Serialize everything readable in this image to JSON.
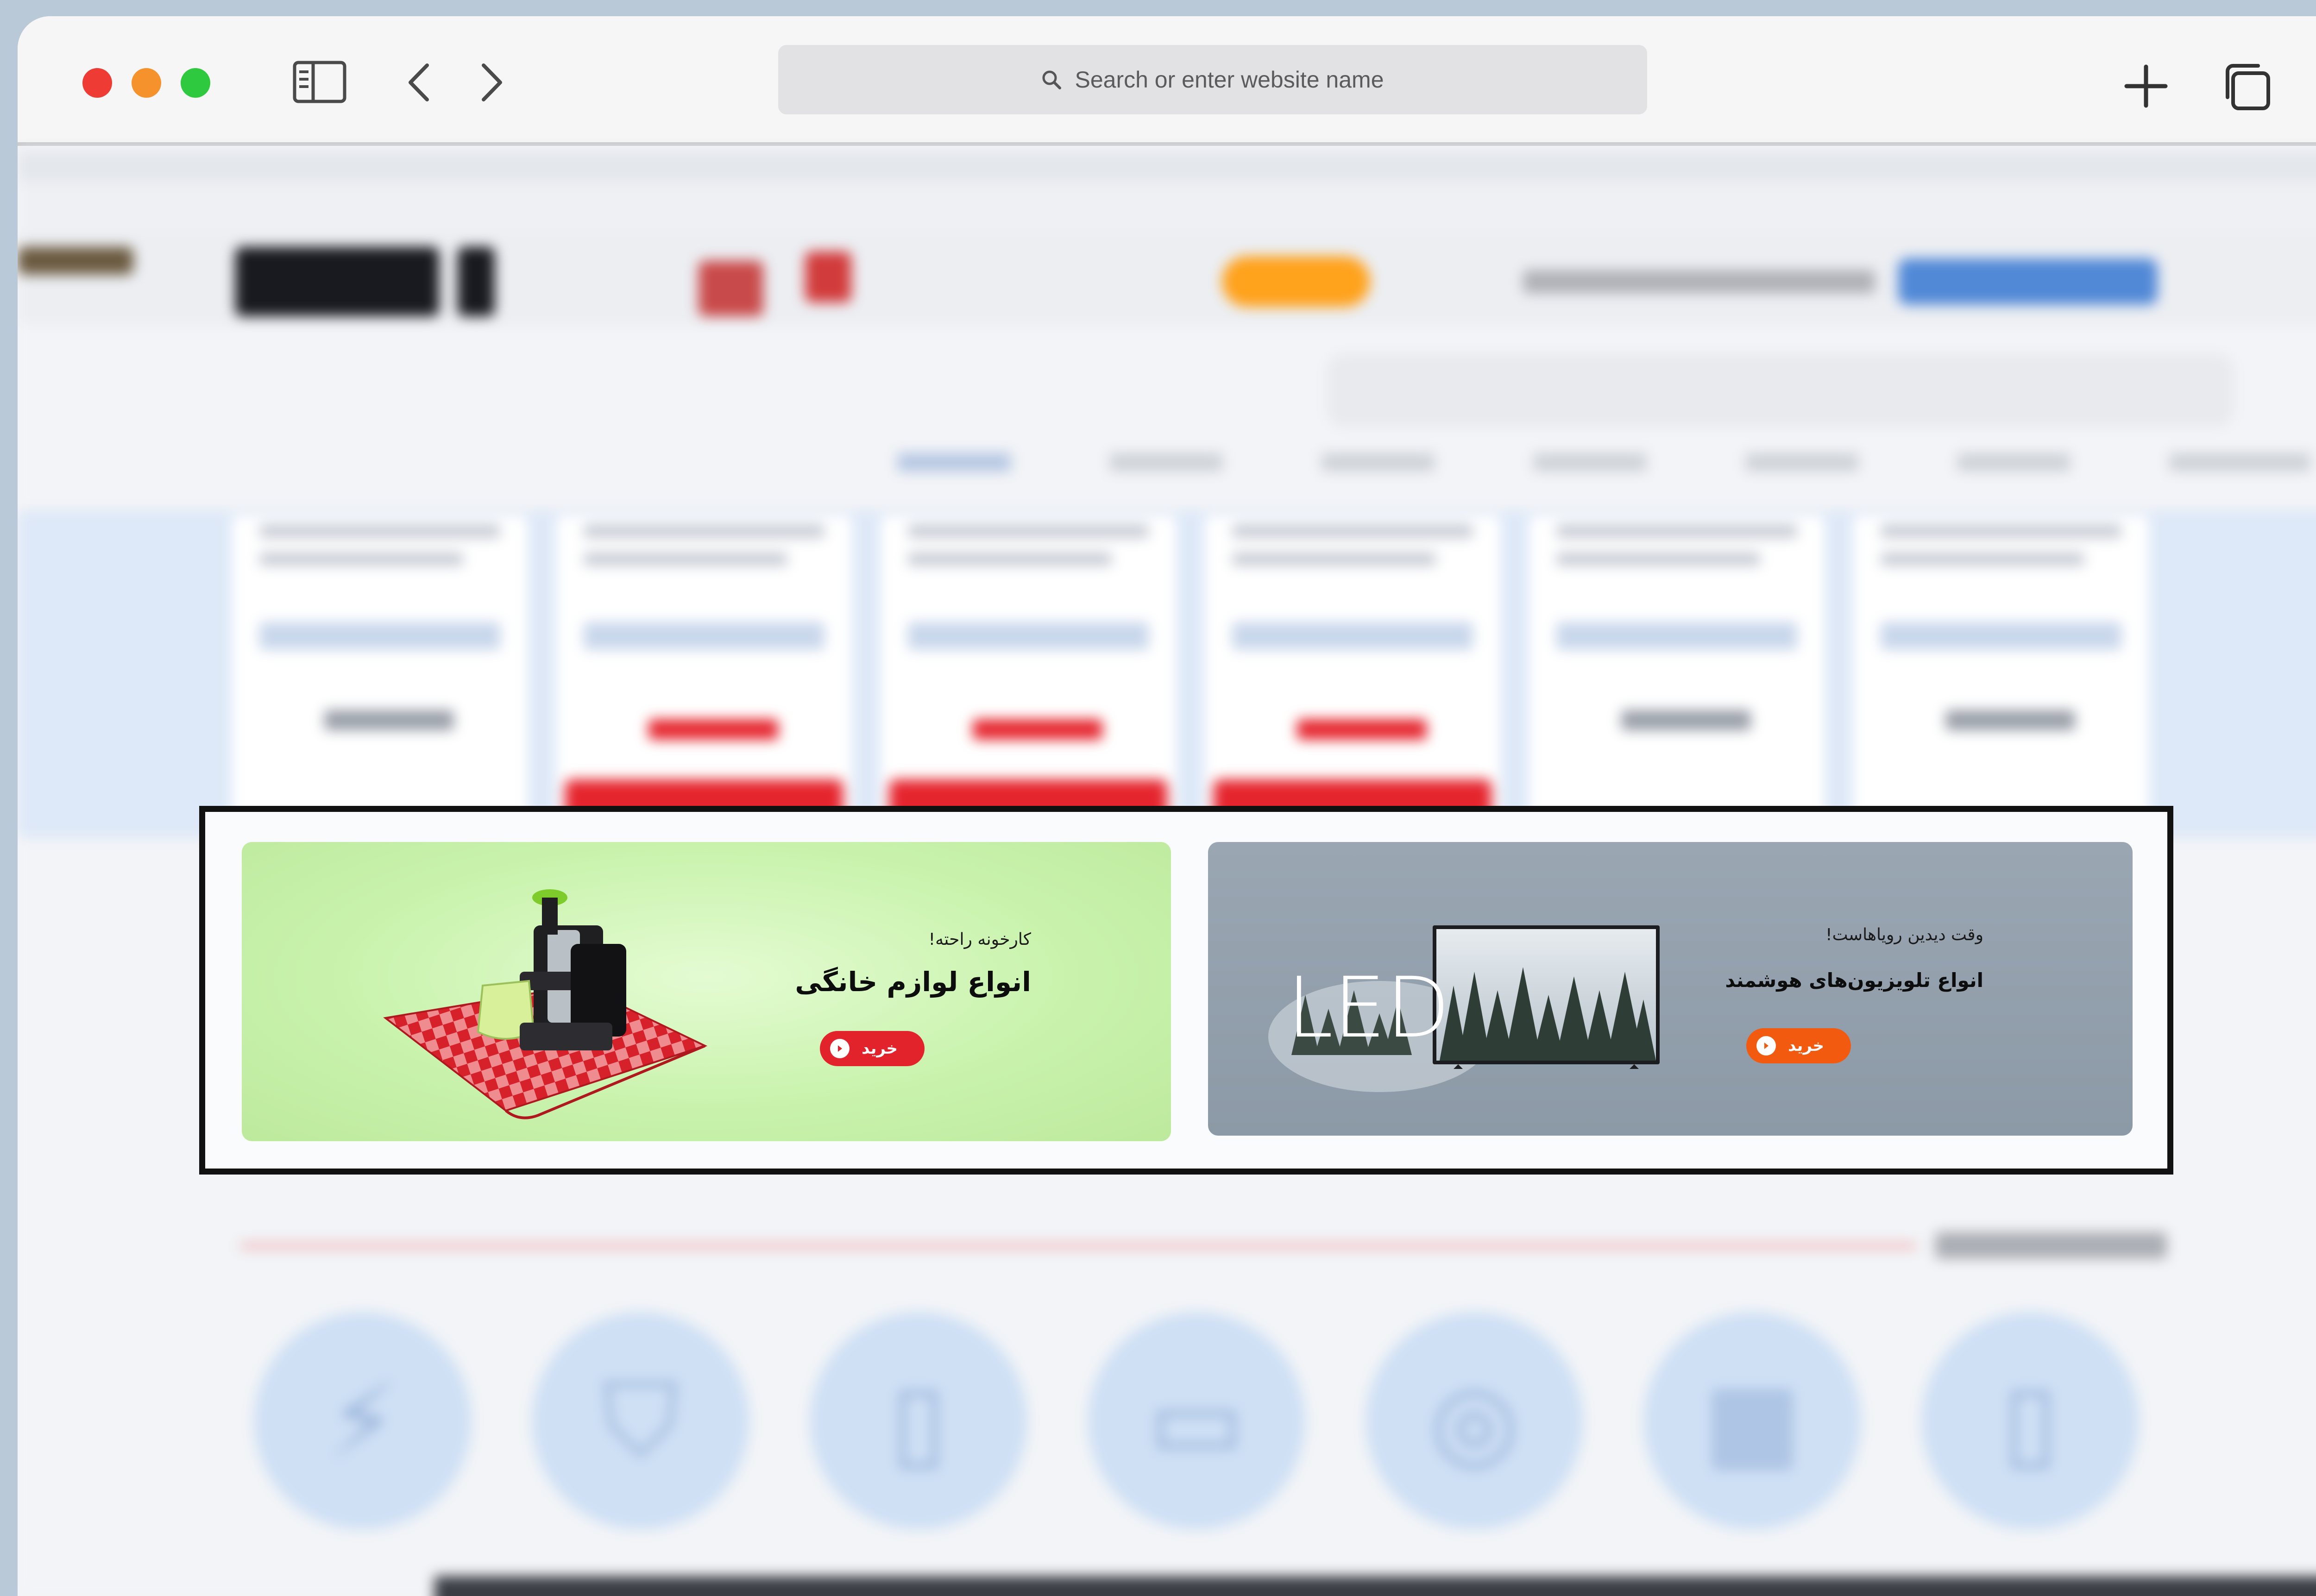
{
  "browser": {
    "address_placeholder": "Search or enter website name",
    "traffic_lights": {
      "close": "#ee3b34",
      "minimize": "#f5922b",
      "zoom": "#2fc93f"
    },
    "icons": [
      "sidebar-icon",
      "back-icon",
      "forward-icon",
      "search-icon",
      "plus-icon",
      "tabs-overview-icon"
    ]
  },
  "banners": {
    "appliances": {
      "tagline": "کارخونه راحته!",
      "title": "انواع لوازم خانگی",
      "button_label": "خرید",
      "button_color": "#e3232c"
    },
    "tv": {
      "tagline": "وقت دیدین رویاهاست!",
      "title": "انواع تلویزیون‌های هوشمند",
      "button_label": "خرید",
      "button_color": "#f25a0f",
      "logo_text": "LED"
    }
  },
  "colors": {
    "frame": "#111111",
    "green_banner": "#c9f3ad",
    "tv_banner": "#929fac"
  }
}
